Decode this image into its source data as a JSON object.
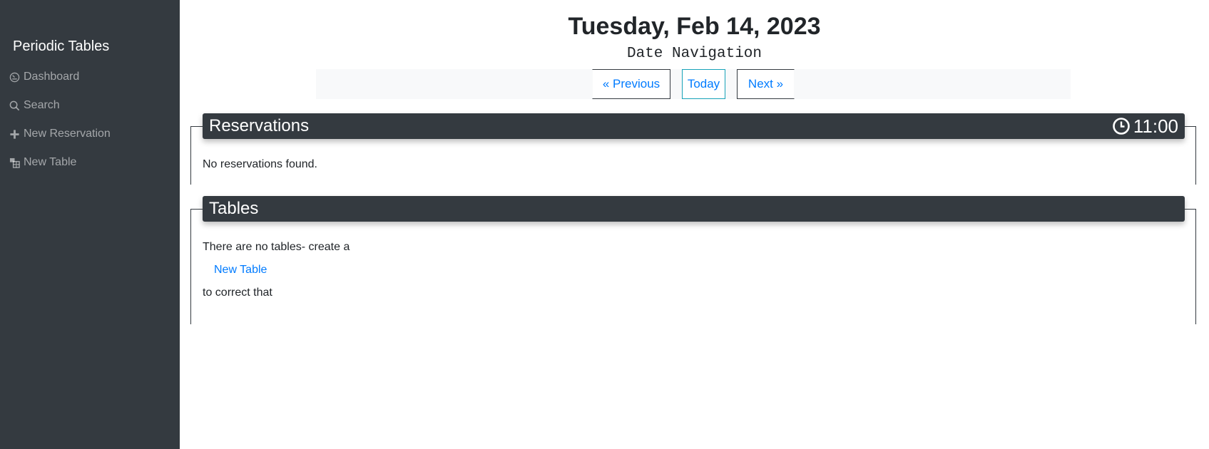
{
  "sidebar": {
    "brand": "Periodic Tables",
    "items": [
      {
        "label": "Dashboard",
        "icon": "dashboard-icon"
      },
      {
        "label": "Search",
        "icon": "search-icon"
      },
      {
        "label": "New Reservation",
        "icon": "plus-icon"
      },
      {
        "label": "New Table",
        "icon": "table-icon"
      }
    ]
  },
  "header": {
    "date_title": "Tuesday, Feb 14, 2023",
    "date_nav_label": "Date Navigation",
    "previous_label": "« Previous",
    "today_label": "Today",
    "next_label": "Next »"
  },
  "reservations": {
    "title": "Reservations",
    "time": "11:00",
    "empty_text": "No reservations found."
  },
  "tables": {
    "title": "Tables",
    "empty_text_before": "There are no tables- create a",
    "link_label": "New Table",
    "empty_text_after": "to correct that"
  },
  "colors": {
    "sidebar_bg": "#343a40",
    "link": "#007bff",
    "today_border": "#17a2b8",
    "nav_bar_bg": "#f8f9fa"
  }
}
